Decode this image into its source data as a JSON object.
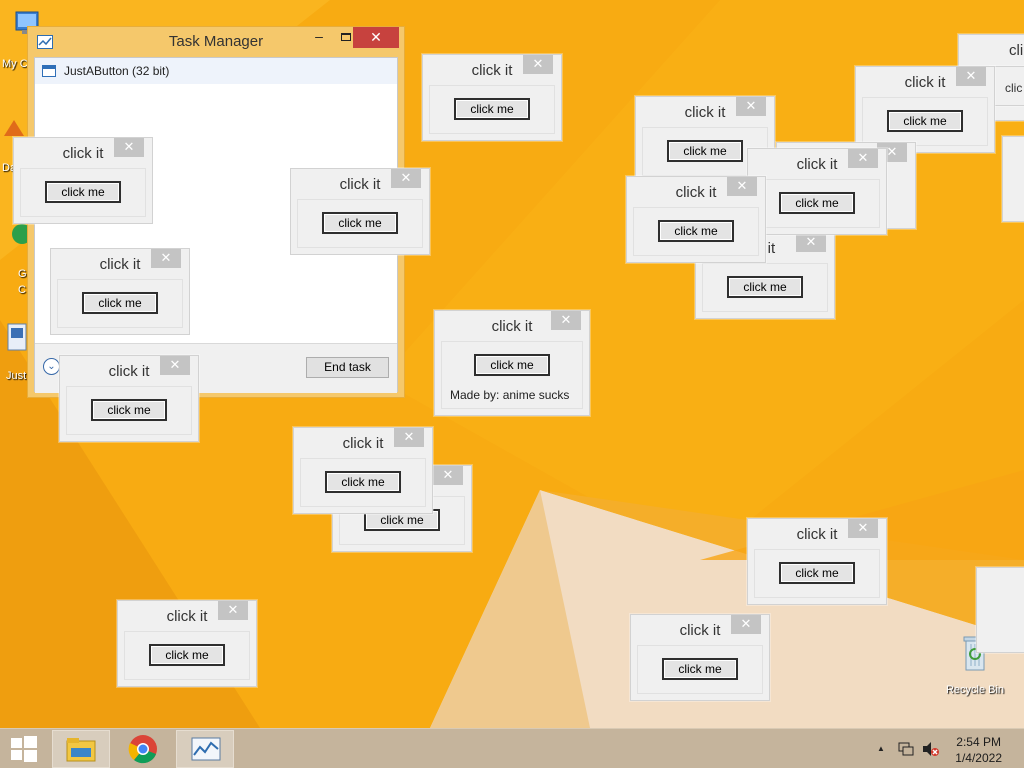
{
  "desktop": {
    "icons": [
      {
        "label": "My C"
      },
      {
        "label": "Da"
      },
      {
        "label": "G\nC"
      },
      {
        "label": "Just"
      },
      {
        "label": "Recycle Bin"
      }
    ]
  },
  "task_manager": {
    "title": "Task Manager",
    "minimize_glyph": "–",
    "close_glyph": "✕",
    "rows": [
      {
        "label": "JustAButton (32 bit)"
      }
    ],
    "end_task_label": "End task",
    "more_details_glyph": "⌄"
  },
  "dialogs": {
    "title": "click it",
    "button_label": "click me",
    "close_glyph": "✕",
    "credit_note": "Made by: anime sucks",
    "partial_titles": [
      "cli",
      "clic",
      "k it"
    ]
  },
  "taskbar": {
    "start_icon": "windows-logo-icon",
    "pinned": [
      {
        "name": "file-explorer-icon"
      },
      {
        "name": "chrome-icon"
      },
      {
        "name": "task-manager-icon"
      }
    ],
    "tray": {
      "show_hidden_glyph": "▲",
      "time": "2:54 PM",
      "date": "1/4/2022"
    }
  },
  "colors": {
    "desktop_bg": "#f7a813",
    "taskbar_bg": "#c5b49c",
    "close_active": "#c7423e",
    "close_inactive": "#c4c4c4"
  }
}
